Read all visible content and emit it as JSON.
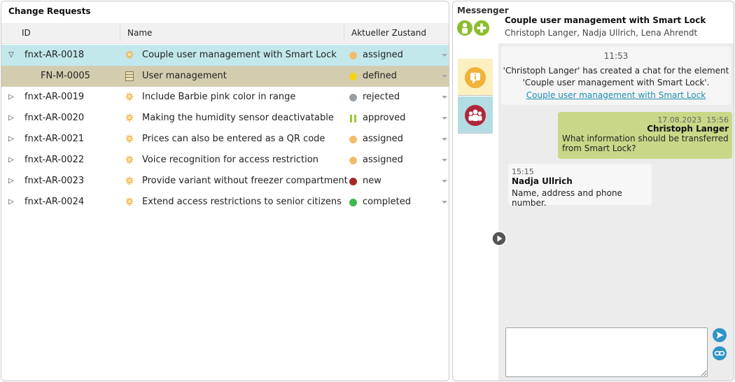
{
  "left": {
    "title": "Change Requests",
    "columns": {
      "id": "ID",
      "name": "Name",
      "status": "Aktueller Zustand"
    },
    "rows": [
      {
        "toggle": "▽",
        "id": "fnxt-AR-0018",
        "icon": "lightbulb-icon",
        "name": "Couple user management with Smart Lock",
        "status": "assigned",
        "status_color": "#f2bd6b",
        "status_icon": "dot",
        "state": "selected"
      },
      {
        "toggle": "",
        "id": "FN-M-0005",
        "icon": "module-icon",
        "name": "User management",
        "status": "defined",
        "status_color": "#f6d117",
        "status_icon": "dot",
        "state": "child"
      },
      {
        "toggle": "▷",
        "id": "fnxt-AR-0019",
        "icon": "lightbulb-icon",
        "name": "Include Barbie pink color in range",
        "status": "rejected",
        "status_color": "#96a0a6",
        "status_icon": "dot",
        "state": ""
      },
      {
        "toggle": "▷",
        "id": "fnxt-AR-0020",
        "icon": "lightbulb-icon",
        "name": "Making the humidity sensor deactivatable",
        "status": "approved",
        "status_color": "#9cc83a",
        "status_icon": "pause",
        "state": ""
      },
      {
        "toggle": "▷",
        "id": "fnxt-AR-0021",
        "icon": "lightbulb-icon",
        "name": "Prices can also be entered as a QR code",
        "status": "assigned",
        "status_color": "#f2bd6b",
        "status_icon": "dot",
        "state": ""
      },
      {
        "toggle": "▷",
        "id": "fnxt-AR-0022",
        "icon": "lightbulb-icon",
        "name": "Voice recognition for access restriction",
        "status": "assigned",
        "status_color": "#f2bd6b",
        "status_icon": "dot",
        "state": ""
      },
      {
        "toggle": "▷",
        "id": "fnxt-AR-0023",
        "icon": "lightbulb-icon",
        "name": "Provide variant without freezer compartment",
        "status": "new",
        "status_color": "#a32a2a",
        "status_icon": "dot",
        "state": ""
      },
      {
        "toggle": "▷",
        "id": "fnxt-AR-0024",
        "icon": "lightbulb-icon",
        "name": "Extend access restrictions to senior citizens",
        "status": "completed",
        "status_color": "#3db74a",
        "status_icon": "dot",
        "state": ""
      }
    ]
  },
  "messenger": {
    "title": "Messenger",
    "chat_title": "Couple user management with Smart Lock",
    "participants": "Christoph Langer, Nadja Ullrich, Lena Ahrendt",
    "system_message": {
      "time": "11:53",
      "line1": "'Christoph Langer' has created a chat for the element",
      "line2": "'Couple user management with Smart Lock'.",
      "link": "Couple user management with Smart Lock"
    },
    "my_message": {
      "date": "17.08.2023",
      "time": "15:56",
      "author": "Christoph Langer",
      "text": "What information should be transferred from Smart Lock?"
    },
    "other_message": {
      "time": "15:15",
      "author": "Nadja Ullrich",
      "text": "Name, address and phone number."
    },
    "input_value": ""
  },
  "colors": {
    "accent_green": "#8cbd2d",
    "selection": "#c3e8ec",
    "child_row": "#d3cdb0",
    "tab_info": "#fcefc0",
    "tab_group": "#b3dde2",
    "link": "#1c8fb0"
  }
}
